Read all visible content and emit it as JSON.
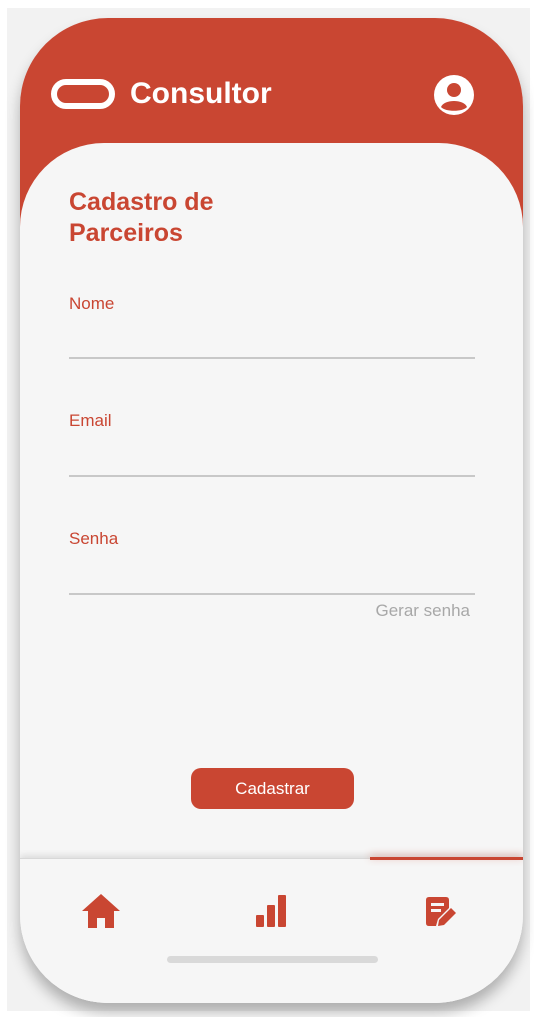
{
  "app": {
    "title": "Consultor",
    "brand_color": "#c94632",
    "logo_icon": "pill-logo-icon",
    "profile_icon": "user-circle-icon"
  },
  "page": {
    "title": "Cadastro de Parceiros"
  },
  "form": {
    "fields": [
      {
        "label": "Nome",
        "value": "",
        "placeholder": ""
      },
      {
        "label": "Email",
        "value": "",
        "placeholder": ""
      },
      {
        "label": "Senha",
        "value": "",
        "placeholder": ""
      }
    ],
    "generate_password_label": "Gerar senha",
    "submit_label": "Cadastrar"
  },
  "bottom_nav": {
    "items": [
      {
        "icon": "home-icon",
        "active": false
      },
      {
        "icon": "bar-chart-icon",
        "active": false
      },
      {
        "icon": "edit-document-icon",
        "active": true
      }
    ]
  }
}
